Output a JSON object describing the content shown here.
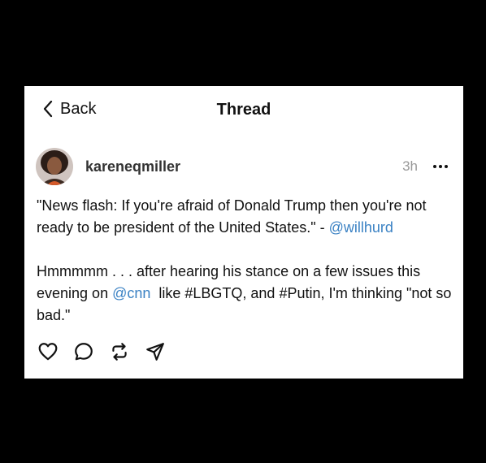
{
  "header": {
    "back_label": "Back",
    "title": "Thread"
  },
  "post": {
    "username": "kareneqmiller",
    "time": "3h",
    "paragraph1": {
      "text": "\"News flash: If you're afraid of Donald Trump then you're not ready to be president of the United States.\" - ",
      "mention": "@willhurd"
    },
    "paragraph2": {
      "text_before": "Hmmmmm . . . after hearing his stance on a few issues this evening on ",
      "mention": "@cnn",
      "text_after": "  like #LBGTQ, and #Putin, I'm thinking \"not so bad.\""
    }
  },
  "actions": [
    "heart-icon",
    "comment-icon",
    "repost-icon",
    "share-icon"
  ],
  "colors": {
    "background": "#000000",
    "card": "#ffffff",
    "mention": "#3b82c4",
    "timestamp": "#999999"
  }
}
